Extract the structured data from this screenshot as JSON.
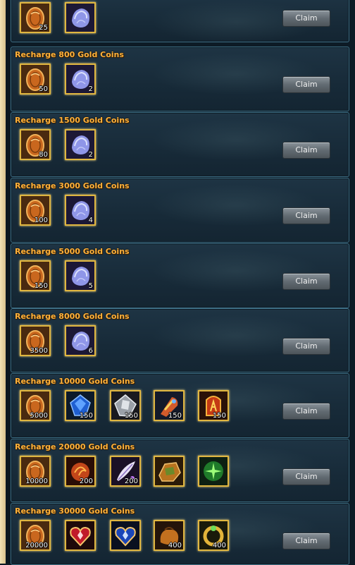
{
  "claim_label": "Claim",
  "rows": [
    {
      "title": "",
      "items": [
        {
          "icon": "gold-coin-icon",
          "qty": "25"
        },
        {
          "icon": "spirit-crystal-icon",
          "qty": ""
        }
      ]
    },
    {
      "title": "Recharge 800 Gold Coins",
      "items": [
        {
          "icon": "gold-coin-icon",
          "qty": "50"
        },
        {
          "icon": "spirit-crystal-icon",
          "qty": "2"
        }
      ]
    },
    {
      "title": "Recharge 1500 Gold Coins",
      "items": [
        {
          "icon": "gold-coin-icon",
          "qty": "80"
        },
        {
          "icon": "spirit-crystal-icon",
          "qty": "2"
        }
      ]
    },
    {
      "title": "Recharge 3000 Gold Coins",
      "items": [
        {
          "icon": "gold-coin-icon",
          "qty": "100"
        },
        {
          "icon": "spirit-crystal-icon",
          "qty": "4"
        }
      ]
    },
    {
      "title": "Recharge 5000 Gold Coins",
      "items": [
        {
          "icon": "gold-coin-icon",
          "qty": "150"
        },
        {
          "icon": "spirit-crystal-icon",
          "qty": "5"
        }
      ]
    },
    {
      "title": "Recharge 8000 Gold Coins",
      "items": [
        {
          "icon": "gold-coin-icon",
          "qty": "3500"
        },
        {
          "icon": "spirit-crystal-icon",
          "qty": "6"
        }
      ]
    },
    {
      "title": "Recharge 10000 Gold Coins",
      "items": [
        {
          "icon": "gold-coin-icon",
          "qty": "5000"
        },
        {
          "icon": "blue-gem-icon",
          "qty": "150"
        },
        {
          "icon": "silver-gem-icon",
          "qty": "150"
        },
        {
          "icon": "enchant-scroll-icon",
          "qty": "150"
        },
        {
          "icon": "red-rune-icon",
          "qty": "150"
        }
      ]
    },
    {
      "title": "Recharge 20000 Gold Coins",
      "items": [
        {
          "icon": "gold-coin-icon",
          "qty": "10000"
        },
        {
          "icon": "fire-orb-icon",
          "qty": "200"
        },
        {
          "icon": "feather-icon",
          "qty": "200"
        },
        {
          "icon": "ore-stone-icon",
          "qty": ""
        },
        {
          "icon": "green-clover-icon",
          "qty": ""
        }
      ]
    },
    {
      "title": "Recharge 30000 Gold Coins",
      "items": [
        {
          "icon": "gold-coin-icon",
          "qty": "20000"
        },
        {
          "icon": "red-heart-gem-icon",
          "qty": ""
        },
        {
          "icon": "blue-heart-gem-icon",
          "qty": ""
        },
        {
          "icon": "leather-pouch-icon",
          "qty": "400"
        },
        {
          "icon": "gold-ring-icon",
          "qty": "400"
        }
      ]
    }
  ]
}
